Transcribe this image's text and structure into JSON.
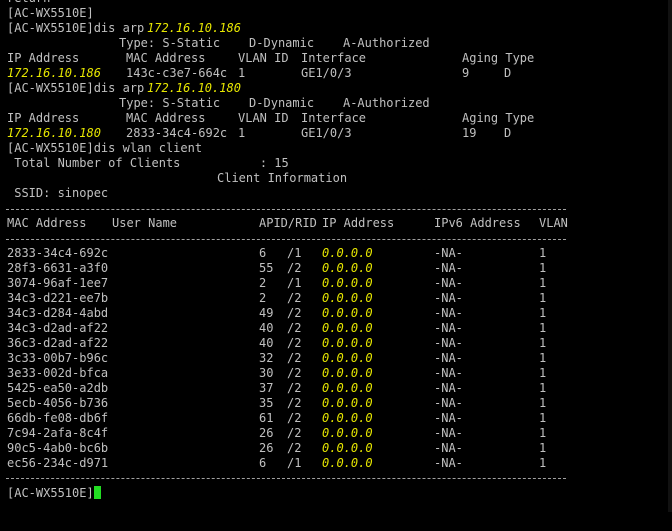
{
  "terminal": {
    "fg_color": "#c0c0c0",
    "ip_highlight_color": "#e6e600",
    "cursor_color": "#22dd22",
    "top_partial": "return",
    "lines": {
      "prompt1": "[AC-WX5510E]",
      "arp1_cmd_prefix": "[AC-WX5510E]dis arp ",
      "arp1_cmd_ip": "172.16.10.186",
      "arp1_types": "Type: S-Static    D-Dynamic    A-Authorized",
      "arp1_h_ip": "IP Address",
      "arp1_h_mac": "MAC Address",
      "arp1_h_vlan": "VLAN ID",
      "arp1_h_iface": "Interface",
      "arp1_h_aging": "Aging Type",
      "arp1_ip": "172.16.10.186",
      "arp1_mac": "143c-c3e7-664c",
      "arp1_vlan": "1",
      "arp1_iface": "GE1/0/3",
      "arp1_aging": "9",
      "arp1_type": "D",
      "arp2_cmd_prefix": "[AC-WX5510E]dis arp ",
      "arp2_cmd_ip": "172.16.10.180",
      "arp2_types": "Type: S-Static    D-Dynamic    A-Authorized",
      "arp2_h_ip": "IP Address",
      "arp2_h_mac": "MAC Address",
      "arp2_h_vlan": "VLAN ID",
      "arp2_h_iface": "Interface",
      "arp2_h_aging": "Aging Type",
      "arp2_ip": "172.16.10.180",
      "arp2_mac": "2833-34c4-692c",
      "arp2_vlan": "1",
      "arp2_iface": "GE1/0/3",
      "arp2_aging": "19",
      "arp2_type": "D",
      "wlan_cmd": "[AC-WX5510E]dis wlan client",
      "total_clients": " Total Number of Clients           : 15",
      "client_info": "Client Information",
      "ssid": " SSID: sinopec",
      "final_prompt": "[AC-WX5510E]"
    },
    "client_table": {
      "headers": {
        "mac": "MAC Address",
        "user": "User Name",
        "apid": "APID/RID",
        "ip": "IP Address",
        "ipv6": "IPv6 Address",
        "vlan": "VLAN"
      },
      "rows": [
        {
          "mac": "2833-34c4-692c",
          "apid": "6",
          "rid": "/1",
          "ip": "0.0.0.0",
          "ipv6": "-NA-",
          "vlan": "1"
        },
        {
          "mac": "28f3-6631-a3f0",
          "apid": "55",
          "rid": "/2",
          "ip": "0.0.0.0",
          "ipv6": "-NA-",
          "vlan": "1"
        },
        {
          "mac": "3074-96af-1ee7",
          "apid": "2",
          "rid": "/1",
          "ip": "0.0.0.0",
          "ipv6": "-NA-",
          "vlan": "1"
        },
        {
          "mac": "34c3-d221-ee7b",
          "apid": "2",
          "rid": "/2",
          "ip": "0.0.0.0",
          "ipv6": "-NA-",
          "vlan": "1"
        },
        {
          "mac": "34c3-d284-4abd",
          "apid": "49",
          "rid": "/2",
          "ip": "0.0.0.0",
          "ipv6": "-NA-",
          "vlan": "1"
        },
        {
          "mac": "34c3-d2ad-af22",
          "apid": "40",
          "rid": "/2",
          "ip": "0.0.0.0",
          "ipv6": "-NA-",
          "vlan": "1"
        },
        {
          "mac": "36c3-d2ad-af22",
          "apid": "40",
          "rid": "/2",
          "ip": "0.0.0.0",
          "ipv6": "-NA-",
          "vlan": "1"
        },
        {
          "mac": "3c33-00b7-b96c",
          "apid": "32",
          "rid": "/2",
          "ip": "0.0.0.0",
          "ipv6": "-NA-",
          "vlan": "1"
        },
        {
          "mac": "3e33-002d-bfca",
          "apid": "30",
          "rid": "/2",
          "ip": "0.0.0.0",
          "ipv6": "-NA-",
          "vlan": "1"
        },
        {
          "mac": "5425-ea50-a2db",
          "apid": "37",
          "rid": "/2",
          "ip": "0.0.0.0",
          "ipv6": "-NA-",
          "vlan": "1"
        },
        {
          "mac": "5ecb-4056-b736",
          "apid": "35",
          "rid": "/2",
          "ip": "0.0.0.0",
          "ipv6": "-NA-",
          "vlan": "1"
        },
        {
          "mac": "66db-fe08-db6f",
          "apid": "61",
          "rid": "/2",
          "ip": "0.0.0.0",
          "ipv6": "-NA-",
          "vlan": "1"
        },
        {
          "mac": "7c94-2afa-8c4f",
          "apid": "26",
          "rid": "/2",
          "ip": "0.0.0.0",
          "ipv6": "-NA-",
          "vlan": "1"
        },
        {
          "mac": "90c5-4ab0-bc6b",
          "apid": "26",
          "rid": "/2",
          "ip": "0.0.0.0",
          "ipv6": "-NA-",
          "vlan": "1"
        },
        {
          "mac": "ec56-234c-d971",
          "apid": "6",
          "rid": "/1",
          "ip": "0.0.0.0",
          "ipv6": "-NA-",
          "vlan": "1"
        }
      ]
    }
  }
}
